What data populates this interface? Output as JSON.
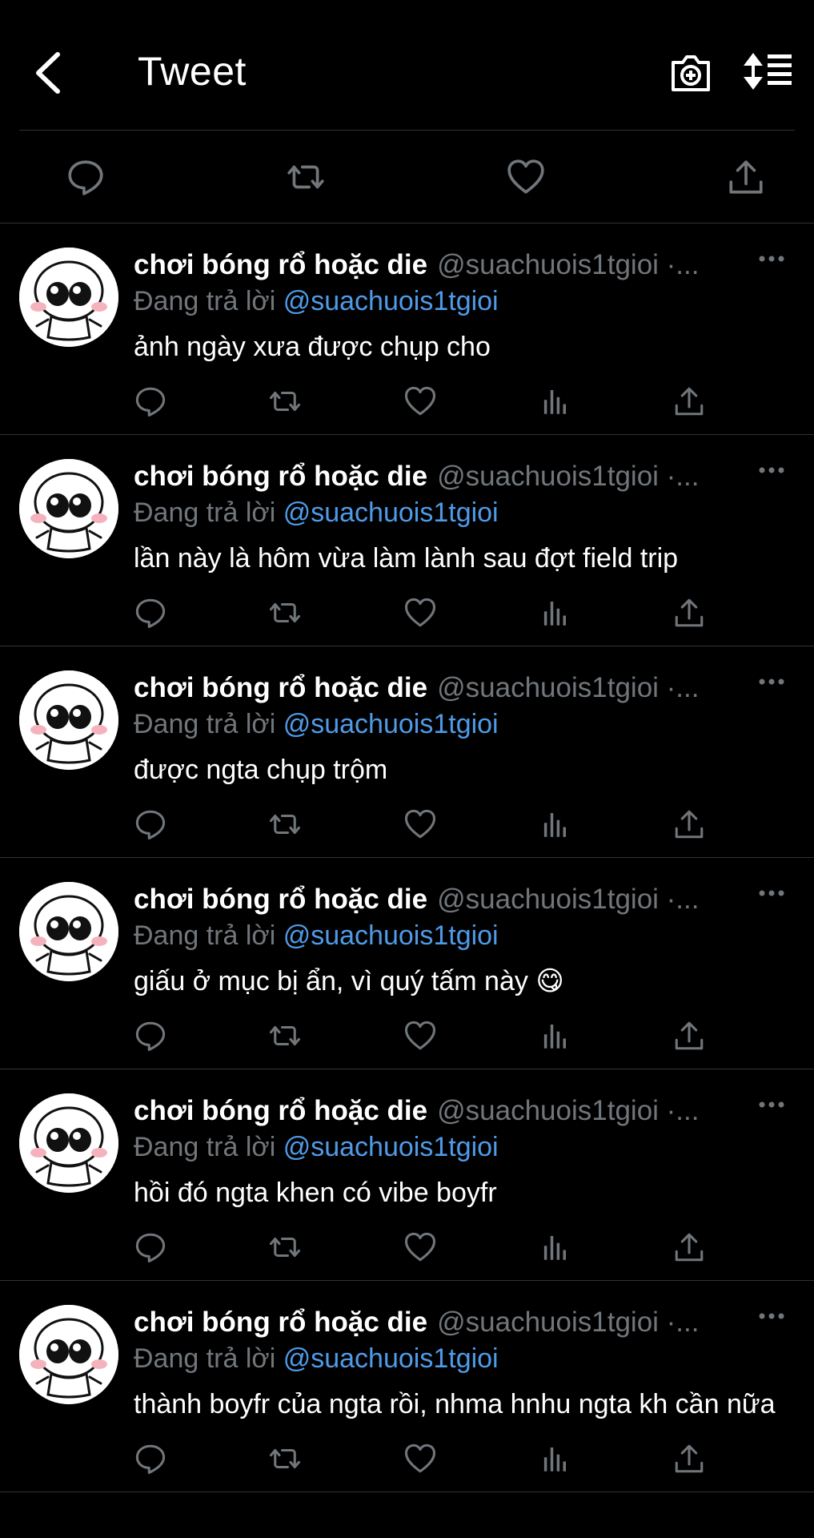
{
  "header": {
    "title": "Tweet"
  },
  "tweets": [
    {
      "name": "chơi bóng rổ hoặc die",
      "handle": "@suachuois1tgioi ·...",
      "reply_prefix": "Đang trả lời",
      "reply_to": "@suachuois1tgioi",
      "text": "ảnh ngày xưa được chụp cho"
    },
    {
      "name": "chơi bóng rổ hoặc die",
      "handle": "@suachuois1tgioi ·...",
      "reply_prefix": "Đang trả lời",
      "reply_to": "@suachuois1tgioi",
      "text": "lần này là hôm vừa làm lành sau đợt field trip"
    },
    {
      "name": "chơi bóng rổ hoặc die",
      "handle": "@suachuois1tgioi ·...",
      "reply_prefix": "Đang trả lời",
      "reply_to": "@suachuois1tgioi",
      "text": "được ngta chụp trộm"
    },
    {
      "name": "chơi bóng rổ hoặc die",
      "handle": "@suachuois1tgioi ·...",
      "reply_prefix": "Đang trả lời",
      "reply_to": "@suachuois1tgioi",
      "text": "giấu ở mục bị ẩn, vì quý tấm này 😋"
    },
    {
      "name": "chơi bóng rổ hoặc die",
      "handle": "@suachuois1tgioi ·...",
      "reply_prefix": "Đang trả lời",
      "reply_to": "@suachuois1tgioi",
      "text": "hồi đó ngta khen có vibe boyfr"
    },
    {
      "name": "chơi bóng rổ hoặc die",
      "handle": "@suachuois1tgioi ·...",
      "reply_prefix": "Đang trả lời",
      "reply_to": "@suachuois1tgioi",
      "text": "thành boyfr của ngta rồi, nhma hnhu ngta kh cần nữa"
    }
  ],
  "colors": {
    "background": "#000000",
    "mention": "#4f9be8",
    "muted": "#71767b",
    "divider": "#2f3336"
  }
}
